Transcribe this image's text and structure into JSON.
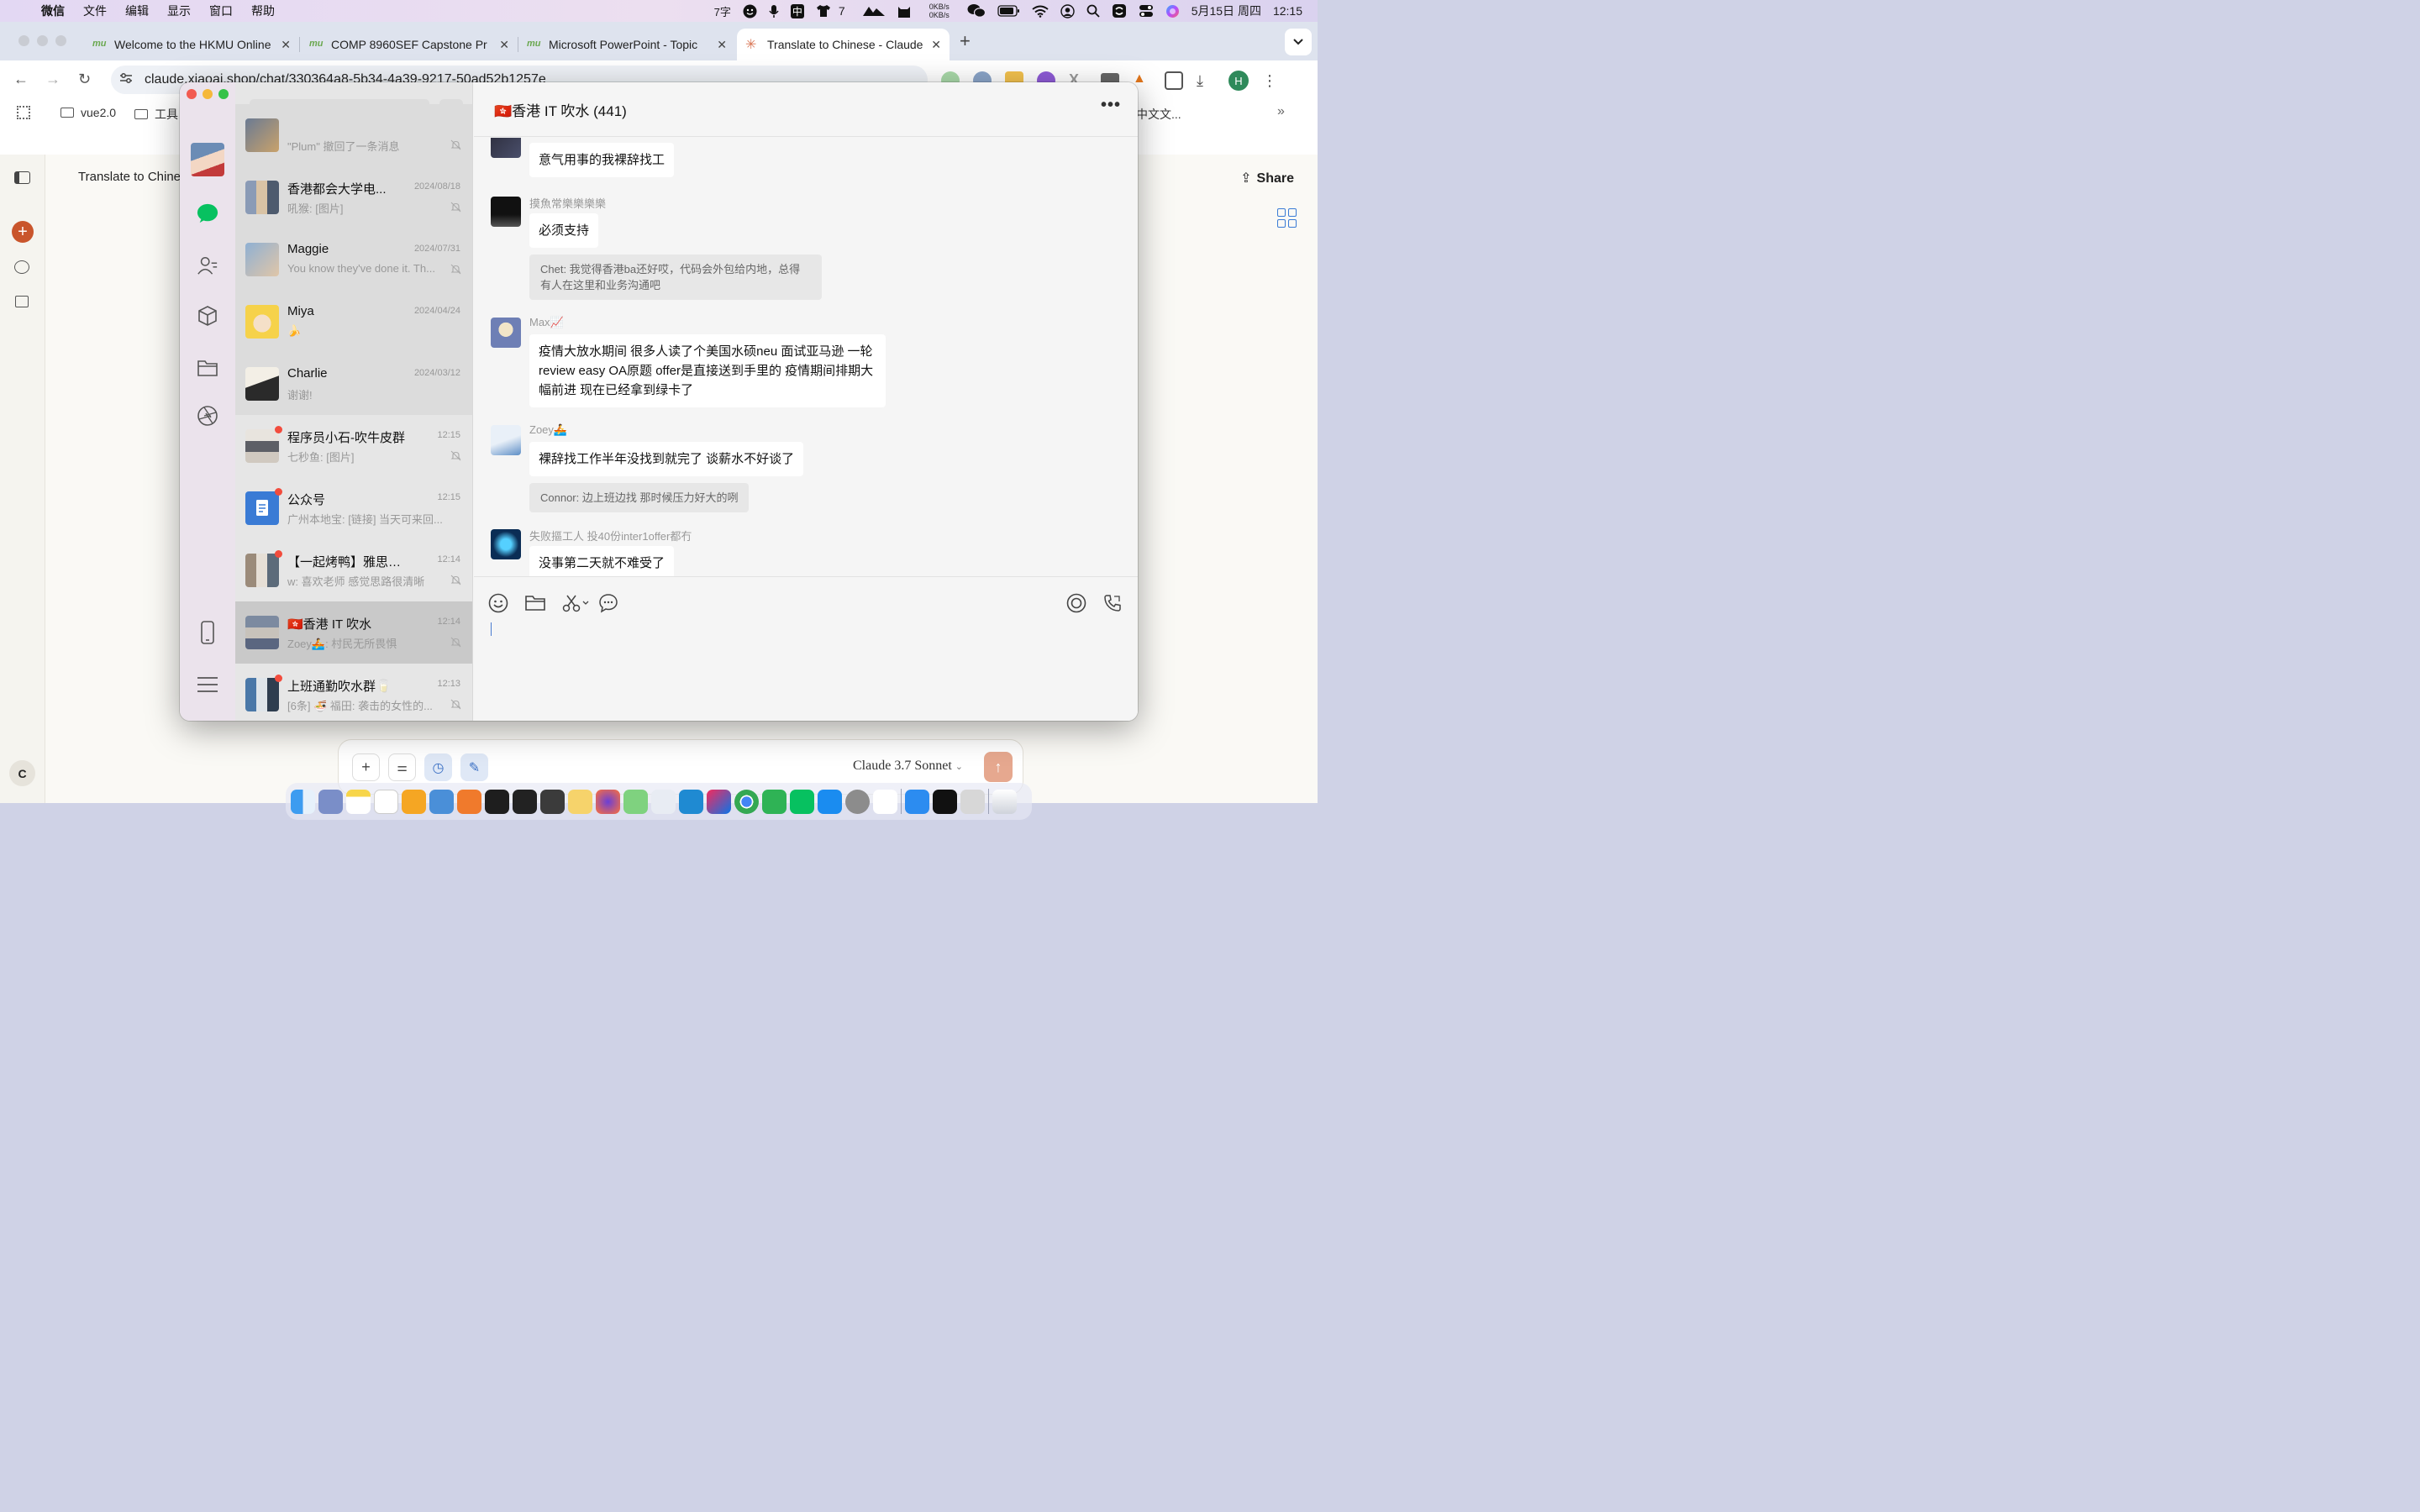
{
  "menubar": {
    "app": "微信",
    "items": [
      "文件",
      "编辑",
      "显示",
      "窗口",
      "帮助"
    ],
    "word_count": "7字",
    "shirt_count": "7",
    "net_up": "0KB/s",
    "net_down": "0KB/s",
    "ime": "中",
    "date": "5月15日 周四",
    "time": "12:15"
  },
  "browser": {
    "tabs": [
      {
        "title": "Welcome to the HKMU Online",
        "favicon": "mu"
      },
      {
        "title": "COMP 8960SEF Capstone Pr",
        "favicon": "mu"
      },
      {
        "title": "Microsoft PowerPoint - Topic",
        "favicon": "mu"
      },
      {
        "title": "Translate to Chinese - Claude",
        "favicon": "claude-icon",
        "active": true
      }
    ],
    "url": "claude.xiaoai.shop/chat/330364a8-5b34-4a39-9217-50ad52b1257e",
    "profile": "H",
    "bookmarks": [
      "vue2.0",
      "工具"
    ],
    "bookmark_right": "中文文..."
  },
  "claude": {
    "title": "Translate to Chinese",
    "share": "Share",
    "model": "Claude 3.7 Sonnet",
    "user_initial": "C"
  },
  "wechat": {
    "search_placeholder": "搜索",
    "conversations": [
      {
        "name": "",
        "time": "",
        "preview": "\"Plum\" 撤回了一条消息",
        "muted": true,
        "unread": false
      },
      {
        "name": "香港都会大学电...",
        "time": "2024/08/18",
        "preview": "吼猴: [图片]",
        "muted": true,
        "unread": false
      },
      {
        "name": "Maggie",
        "time": "2024/07/31",
        "preview": "You know they've done it. Th...",
        "muted": true,
        "unread": false
      },
      {
        "name": "Miya",
        "time": "2024/04/24",
        "preview": "🍌",
        "muted": false,
        "unread": false
      },
      {
        "name": "Charlie",
        "time": "2024/03/12",
        "preview": "谢谢!",
        "muted": false,
        "unread": false
      },
      {
        "name": "程序员小石-吹牛皮群",
        "time": "12:15",
        "preview": "七秒鱼: [图片]",
        "muted": true,
        "unread": true
      },
      {
        "name": "公众号",
        "time": "12:15",
        "preview": "广州本地宝: [链接] 当天可来回...",
        "muted": false,
        "unread": true
      },
      {
        "name": "【一起烤鸭】雅思学习...",
        "time": "12:14",
        "preview": "w: 喜欢老师 感觉思路很清晰",
        "muted": true,
        "unread": true
      },
      {
        "name": "🇭🇰香港 IT 吹水",
        "time": "12:14",
        "preview": "Zoey🚣: 村民无所畏惧",
        "muted": true,
        "unread": false,
        "selected": true
      },
      {
        "name": "上班通勤吹水群🥛",
        "time": "12:13",
        "preview": "[6条] 🍜 福田: 袭击的女性的...",
        "muted": true,
        "unread": true
      }
    ],
    "chat": {
      "title": "🇭🇰香港 IT 吹水 (441)",
      "messages": [
        {
          "sender": "",
          "text": "意气用事的我裸辞找工"
        },
        {
          "sender": "摸魚常樂樂樂樂",
          "text": "必须支持",
          "quote": "Chet: 我觉得香港ba还好哎，代码会外包给内地，总得有人在这里和业务沟通吧"
        },
        {
          "sender": "Max📈",
          "text": "疫情大放水期间 很多人读了个美国水硕neu 面试亚马逊 一轮review easy OA原题 offer是直接送到手里的 疫情期间排期大幅前进 现在已经拿到绿卡了"
        },
        {
          "sender": "Zoey🚣",
          "text": "裸辞找工作半年没找到就完了 谈薪水不好谈了",
          "quote": "Connor: 边上班边找 那时候压力好大的咧"
        },
        {
          "sender": "失败摳工人 投40份inter1offer都冇",
          "text": "没事第二天就不难受了"
        }
      ]
    }
  }
}
